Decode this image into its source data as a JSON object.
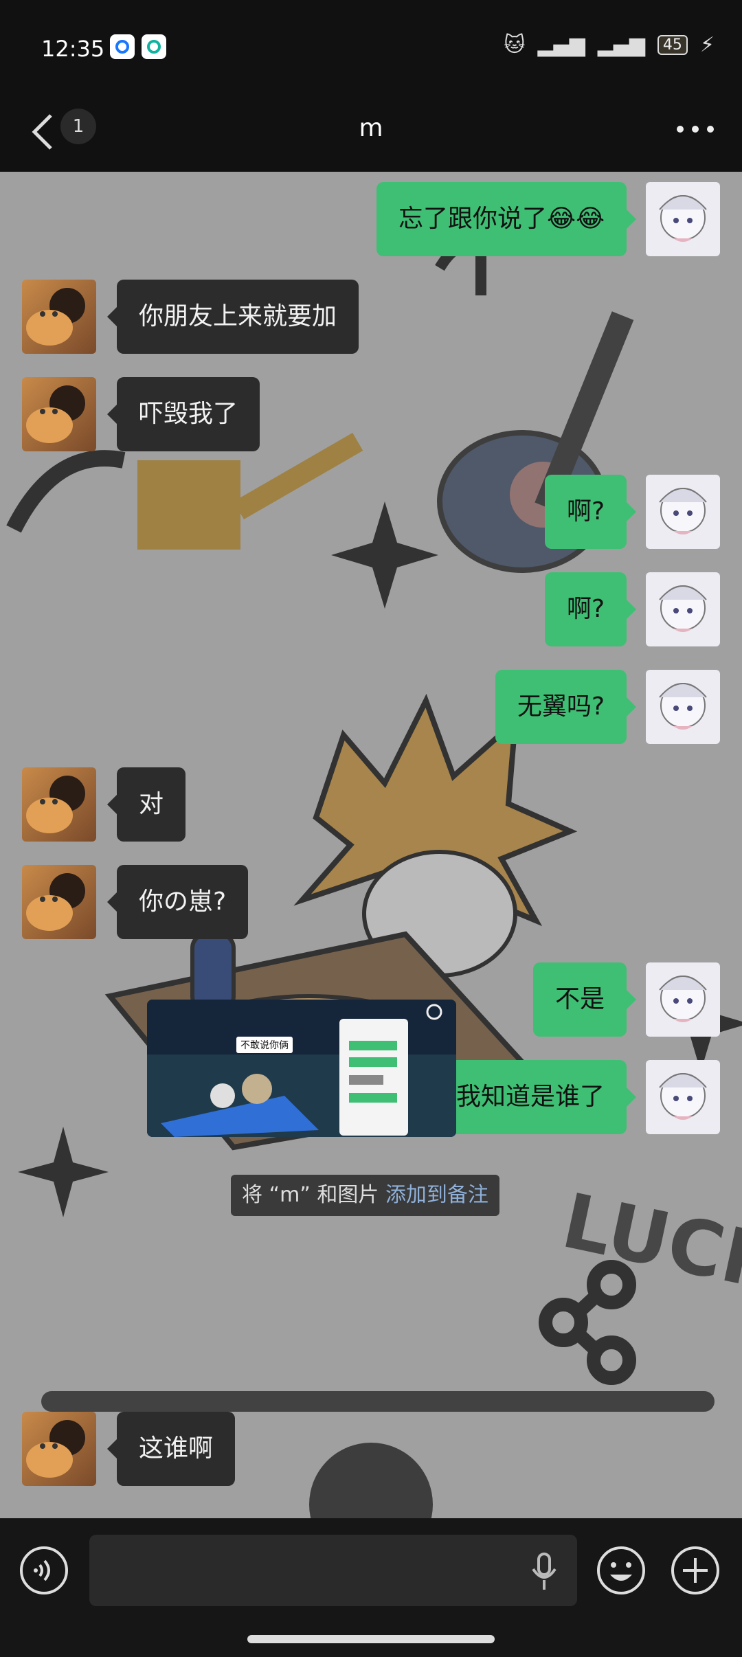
{
  "status": {
    "time": "12:35",
    "battery": "45"
  },
  "header": {
    "unread": "1",
    "title": "m"
  },
  "messages": [
    {
      "side": "right",
      "text": "忘了跟你说了😂😂"
    },
    {
      "side": "left",
      "text": "你朋友上来就要加"
    },
    {
      "side": "left",
      "text": "吓毁我了"
    },
    {
      "side": "right",
      "text": "啊?"
    },
    {
      "side": "right",
      "text": "啊?"
    },
    {
      "side": "right",
      "text": "无翼吗?"
    },
    {
      "side": "left",
      "text": "对"
    },
    {
      "side": "left",
      "text": "你の崽?"
    },
    {
      "side": "right",
      "text": "不是"
    },
    {
      "side": "right",
      "text": "我知道是谁了"
    },
    {
      "side": "left",
      "text": "这谁啊"
    }
  ],
  "image_msg": {
    "caption_tag": "不敢说你俩"
  },
  "system_note": {
    "prefix": "将 “m” 和图片",
    "link": "添加到备注"
  },
  "icons": {
    "back": "chevron-left-icon",
    "more": "more-horizontal-icon",
    "voice": "voice-icon",
    "mic": "microphone-icon",
    "emoji": "emoji-icon",
    "plus": "plus-icon"
  },
  "colors": {
    "out_bubble": "#3fbf74",
    "in_bubble": "#2c2c2c",
    "link": "#8fb0d9"
  }
}
